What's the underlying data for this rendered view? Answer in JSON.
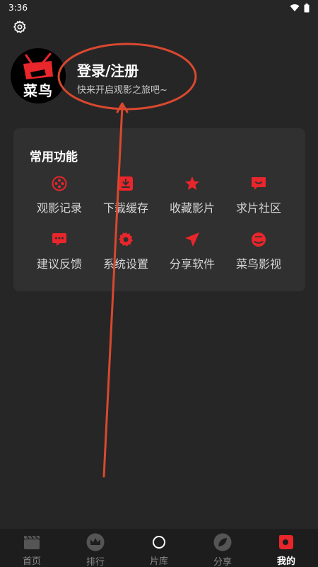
{
  "status_bar": {
    "time": "3:36"
  },
  "profile": {
    "avatar_text": "菜鸟",
    "login_label": "登录/注册",
    "tagline": "快来开启观影之旅吧~"
  },
  "functions": {
    "title": "常用功能",
    "items": [
      {
        "label": "观影记录",
        "icon": "film-reel-icon"
      },
      {
        "label": "下载缓存",
        "icon": "download-icon"
      },
      {
        "label": "收藏影片",
        "icon": "star-icon"
      },
      {
        "label": "求片社区",
        "icon": "chat-bubble-icon"
      },
      {
        "label": "建议反馈",
        "icon": "feedback-icon"
      },
      {
        "label": "系统设置",
        "icon": "gear-icon"
      },
      {
        "label": "分享软件",
        "icon": "send-icon"
      },
      {
        "label": "菜鸟影视",
        "icon": "app-logo-icon"
      }
    ]
  },
  "tabbar": {
    "tabs": [
      {
        "label": "首页",
        "icon": "clapperboard-icon",
        "active": false
      },
      {
        "label": "排行",
        "icon": "crown-icon",
        "active": false
      },
      {
        "label": "片库",
        "icon": "circle-icon",
        "active": false
      },
      {
        "label": "分享",
        "icon": "leaf-icon",
        "active": false
      },
      {
        "label": "我的",
        "icon": "profile-icon",
        "active": true
      }
    ]
  },
  "colors": {
    "accent": "#e8262b",
    "annotation": "#d9482f",
    "background": "#262626",
    "card": "#303030"
  }
}
